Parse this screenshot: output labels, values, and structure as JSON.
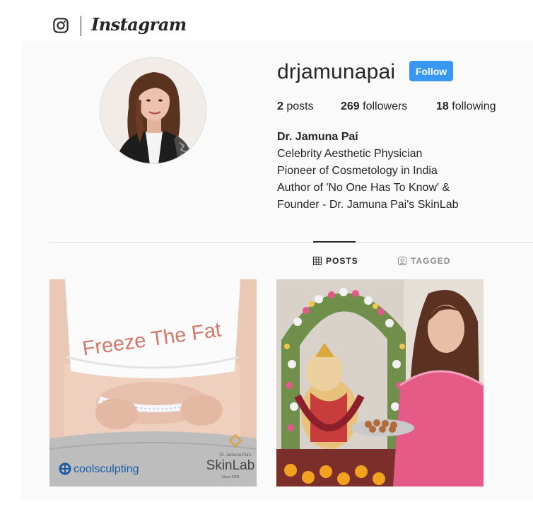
{
  "header": {
    "logo_icon": "instagram-camera-icon",
    "wordmark": "Instagram"
  },
  "profile": {
    "username": "drjamunapai",
    "follow_label": "Follow",
    "stats": {
      "posts_count": "2",
      "posts_label": "posts",
      "followers_count": "269",
      "followers_label": "followers",
      "following_count": "18",
      "following_label": "following"
    },
    "bio": {
      "name": "Dr. Jamuna Pai",
      "lines": [
        "Celebrity Aesthetic Physician",
        "Pioneer of Cosmetology in India",
        "Author of 'No One Has To Know' &",
        "Founder - Dr. Jamuna Pai's SkinLab"
      ]
    }
  },
  "tabs": [
    {
      "label": "POSTS",
      "icon": "grid-icon",
      "active": true
    },
    {
      "label": "TAGGED",
      "icon": "tagged-icon",
      "active": false
    }
  ],
  "posts": [
    {
      "headline": "Freeze The Fat",
      "brand_left": "coolsculpting",
      "brand_right_small": "Dr. Jamuna Pai's",
      "brand_right": "SkinLab",
      "brand_right_since": "Since 1994"
    },
    {
      "description_icon": "photo-icon"
    }
  ],
  "colors": {
    "follow_button": "#3897f0",
    "page_background": "#fafafa",
    "text": "#262626",
    "muted": "#8e8e8e"
  }
}
